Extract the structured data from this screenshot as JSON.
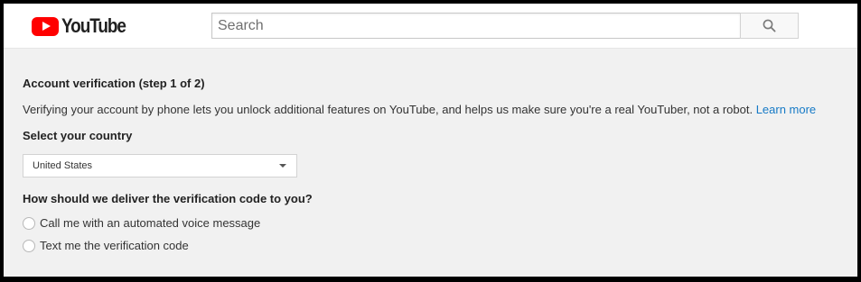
{
  "header": {
    "logo_text": "YouTube",
    "search_placeholder": "Search"
  },
  "verification": {
    "heading": "Account verification (step 1 of 2)",
    "description": "Verifying your account by phone lets you unlock additional features on YouTube, and helps us make sure you're a real YouTuber, not a robot.",
    "learn_more": "Learn more",
    "country_label": "Select your country",
    "country_selected": "United States",
    "delivery_label": "How should we deliver the verification code to you?",
    "options": [
      {
        "label": "Call me with an automated voice message"
      },
      {
        "label": "Text me the verification code"
      }
    ]
  },
  "colors": {
    "brand_red": "#ff0000",
    "link_blue": "#167ac6",
    "page_bg": "#f1f1f1"
  }
}
